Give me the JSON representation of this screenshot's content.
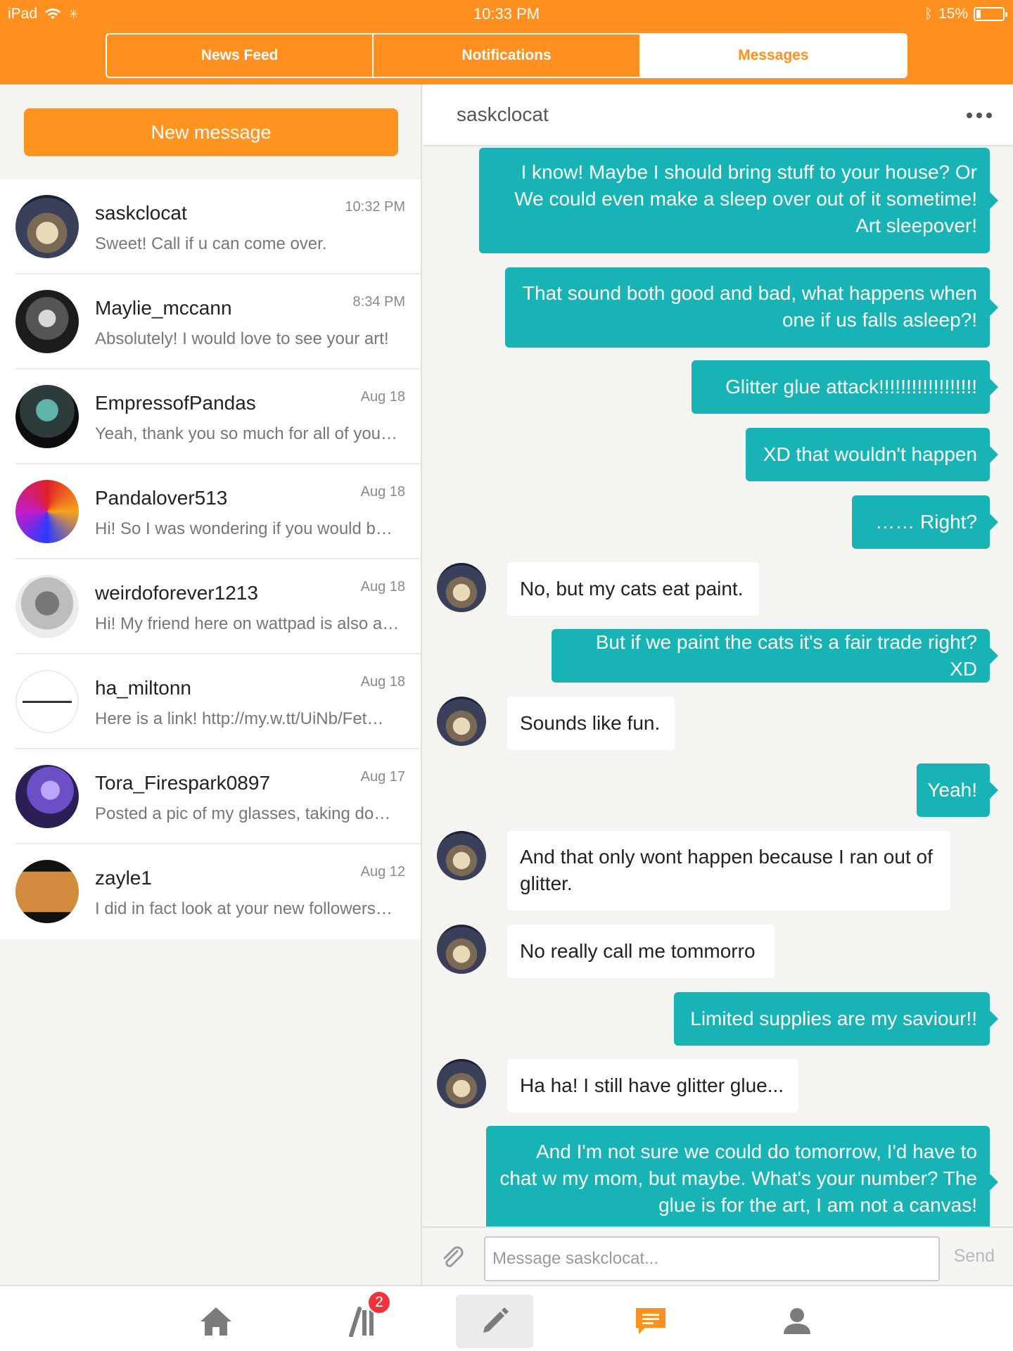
{
  "status_bar": {
    "device": "iPad",
    "time": "10:33 PM",
    "battery": "15%"
  },
  "top_tabs": [
    {
      "label": "News Feed",
      "active": false
    },
    {
      "label": "Notifications",
      "active": false
    },
    {
      "label": "Messages",
      "active": true
    }
  ],
  "sidebar": {
    "new_message_label": "New message",
    "conversations": [
      {
        "name": "saskclocat",
        "time": "10:32 PM",
        "preview": "Sweet! Call if u can come over."
      },
      {
        "name": "Maylie_mccann",
        "time": "8:34 PM",
        "preview": "Absolutely! I would love to see your art!"
      },
      {
        "name": "EmpressofPandas",
        "time": "Aug 18",
        "preview": "Yeah, thank you so much for all of you…"
      },
      {
        "name": "Pandalover513",
        "time": "Aug 18",
        "preview": "Hi! So I was wondering if you would b…"
      },
      {
        "name": "weirdoforever1213",
        "time": "Aug 18",
        "preview": "Hi! My friend here on wattpad is also a…"
      },
      {
        "name": "ha_miltonn",
        "time": "Aug 18",
        "preview": "Here is a link! http://my.w.tt/UiNb/Fet…"
      },
      {
        "name": "Tora_Firespark0897",
        "time": "Aug 17",
        "preview": "Posted a pic of my glasses, taking do…"
      },
      {
        "name": "zayle1",
        "time": "Aug 12",
        "preview": "I did in fact look at your new followers…"
      }
    ]
  },
  "chat": {
    "title": "saskclocat",
    "messages": [
      {
        "dir": "out",
        "text": "I know! Maybe I should bring stuff to your house? Or We could even make a sleep over out of it sometime! Art sleepover!"
      },
      {
        "dir": "out",
        "text": "That sound both good and bad, what happens when one if us falls asleep?!"
      },
      {
        "dir": "out",
        "text": "Glitter glue attack!!!!!!!!!!!!!!!!!!"
      },
      {
        "dir": "out",
        "text": "XD that wouldn't happen"
      },
      {
        "dir": "out",
        "text": "…… Right?"
      },
      {
        "dir": "in",
        "text": "No, but my cats eat paint."
      },
      {
        "dir": "out",
        "text": "But if we paint the cats it's a fair trade right? XD"
      },
      {
        "dir": "in",
        "text": "Sounds like fun."
      },
      {
        "dir": "out",
        "text": "Yeah!"
      },
      {
        "dir": "in",
        "text": "And that only wont happen because I ran out of glitter."
      },
      {
        "dir": "in",
        "text": "No really call me tommorro"
      },
      {
        "dir": "out",
        "text": "Limited supplies are my saviour!!"
      },
      {
        "dir": "in",
        "text": "Ha ha! I still have glitter glue..."
      },
      {
        "dir": "out",
        "text": "And I'm not sure we could do tomorrow, I'd have to chat w my mom, but maybe. What's your number? The glue is for the art, I am not a canvas!"
      }
    ],
    "input_placeholder": "Message saskclocat...",
    "send_label": "Send"
  },
  "bottom_tabs": [
    {
      "icon": "home-icon"
    },
    {
      "icon": "library-icon",
      "badge": "2"
    },
    {
      "icon": "write-icon",
      "selected": true
    },
    {
      "icon": "messages-icon",
      "active": true
    },
    {
      "icon": "profile-icon"
    }
  ],
  "colors": {
    "brand_orange": "#ff8f1f",
    "bubble_teal": "#18b3b5",
    "badge_red": "#f0323a"
  }
}
